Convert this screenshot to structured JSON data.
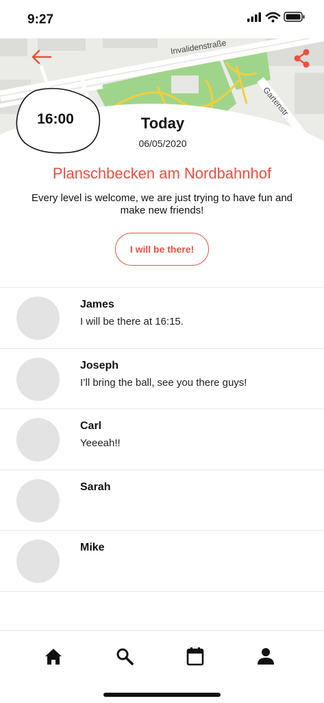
{
  "status_bar": {
    "time": "9:27"
  },
  "map": {
    "street_1": "Invalidenstraße",
    "street_2": "Gartenstr"
  },
  "event": {
    "time": "16:00",
    "day": "Today",
    "date": "06/05/2020",
    "title": "Planschbecken am Nordbahnhof",
    "description": "Every level is welcome, we are just trying to have fun and make new friends!",
    "rsvp_label": "I will be there!"
  },
  "comments": [
    {
      "name": "James",
      "text": "I will be there at 16:15."
    },
    {
      "name": "Joseph",
      "text": "I’ll bring the ball, see you there guys!"
    },
    {
      "name": "Carl",
      "text": "Yeeeah!!"
    },
    {
      "name": "Sarah",
      "text": ""
    },
    {
      "name": "Mike",
      "text": ""
    }
  ],
  "icons": {
    "back": "arrow-left-icon",
    "share": "share-icon",
    "home": "home-icon",
    "search": "search-icon",
    "calendar": "calendar-icon",
    "profile": "person-icon"
  },
  "colors": {
    "accent": "#f04e3e",
    "avatar": "#e3e3e3",
    "park": "#9fd58a",
    "path": "#f2cf3a"
  }
}
